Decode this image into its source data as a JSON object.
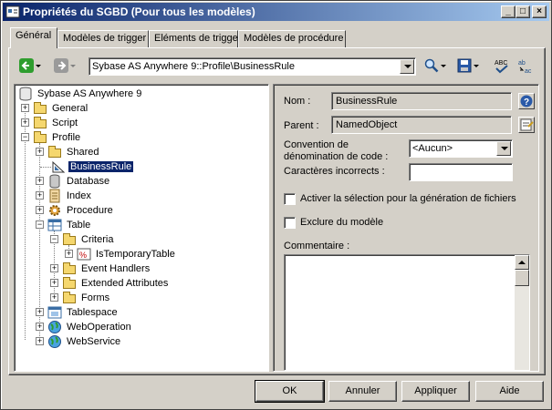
{
  "window": {
    "title": "Propriétés du SGBD (Pour tous les modèles)"
  },
  "title_buttons": [
    "_",
    "□",
    "×"
  ],
  "tabs": [
    "Général",
    "Modèles de trigger",
    "Eléments de trigger",
    "Modèles de procédure"
  ],
  "toolbar": {
    "path": "Sybase AS Anywhere 9::Profile\\BusinessRule"
  },
  "tree": {
    "root": "Sybase AS Anywhere 9",
    "nodes": [
      "General",
      "Script",
      "Profile",
      "Shared",
      "BusinessRule",
      "Database",
      "Index",
      "Procedure",
      "Table",
      "Criteria",
      "IsTemporaryTable",
      "Event Handlers",
      "Extended Attributes",
      "Forms",
      "Tablespace",
      "WebOperation",
      "WebService"
    ]
  },
  "form": {
    "nom_label": "Nom :",
    "nom_value": "BusinessRule",
    "parent_label": "Parent :",
    "parent_value": "NamedObject",
    "convention_label_1": "Convention de",
    "convention_label_2": "dénomination de code :",
    "convention_value": "<Aucun>",
    "caracteres_label": "Caractères incorrects :",
    "caracteres_value": "",
    "activer_label": "Activer la sélection pour la génération de fichiers",
    "exclure_label": "Exclure du modèle",
    "commentaire_label": "Commentaire :"
  },
  "buttons": {
    "ok": "OK",
    "annuler": "Annuler",
    "appliquer": "Appliquer",
    "aide": "Aide"
  },
  "colors": {
    "face": "#d4d0c8",
    "title_start": "#0a246a",
    "title_end": "#a6caf0",
    "selection": "#0a246a"
  }
}
